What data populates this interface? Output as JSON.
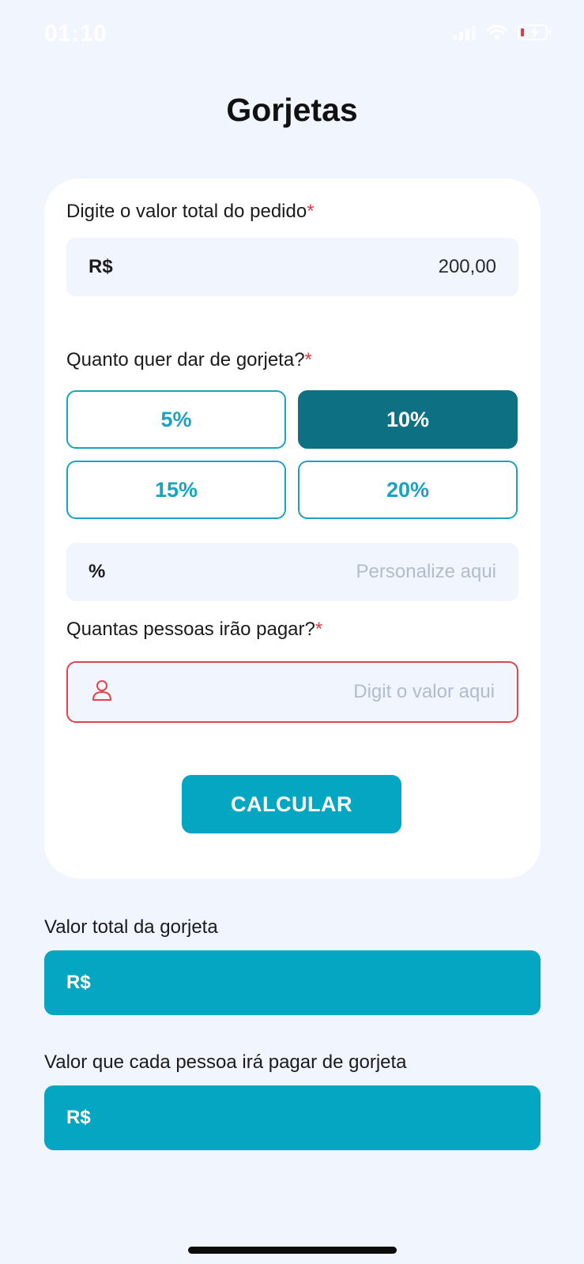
{
  "status_bar": {
    "time": "01:10",
    "icons": [
      "signal-icon",
      "wifi-icon",
      "battery-charging-icon"
    ]
  },
  "title": "Gorjetas",
  "form": {
    "order_total": {
      "label": "Digite o valor total do pedido",
      "required_mark": "*",
      "prefix": "R$",
      "value": "200,00"
    },
    "tip": {
      "label": "Quanto quer dar de gorjeta?",
      "required_mark": "*",
      "options": [
        "5%",
        "10%",
        "15%",
        "20%"
      ],
      "selected": "10%",
      "custom_prefix": "%",
      "custom_placeholder": "Personalize aqui"
    },
    "people": {
      "label": "Quantas pessoas irão pagar?",
      "required_mark": "*",
      "icon": "person-icon",
      "placeholder": "Digit o valor aqui"
    },
    "submit_label": "CALCULAR"
  },
  "results": {
    "total_tip": {
      "label": "Valor total da gorjeta",
      "prefix": "R$"
    },
    "per_person": {
      "label": "Valor que cada pessoa irá pagar de gorjeta",
      "prefix": "R$"
    }
  },
  "colors": {
    "background": "#f0f5fe",
    "accent": "#05a6c2",
    "selected": "#0e7183",
    "error": "#e0444f"
  }
}
